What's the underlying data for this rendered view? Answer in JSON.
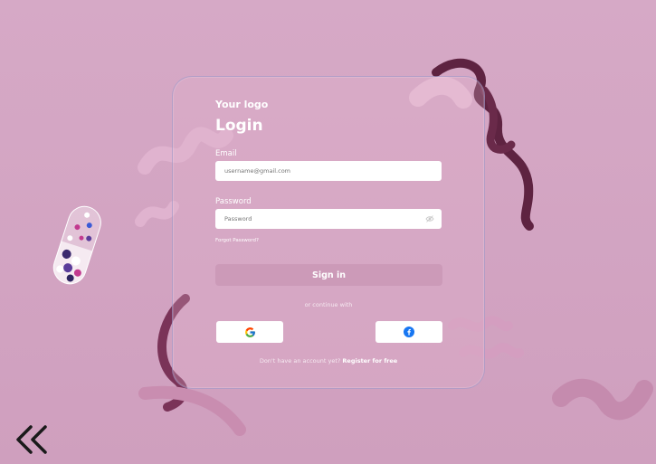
{
  "brand": {
    "logo_text": "Your logo"
  },
  "form": {
    "title": "Login",
    "email_label": "Email",
    "email_placeholder": "username@gmail.com",
    "password_label": "Password",
    "password_placeholder": "Password",
    "forgot_password": "Forgot Password?",
    "signin_label": "Sign in",
    "continue_text": "or continue with",
    "register_prompt": "Don't have an account yet?",
    "register_link": "Register for free"
  },
  "social": {
    "google_icon": "google-icon",
    "facebook_icon": "facebook-icon"
  },
  "nav": {
    "back_icon": "double-chevron-left-icon"
  },
  "colors": {
    "background": "#d3a6c3",
    "accent_dark": "#5a1f3a",
    "button": "#c896b4",
    "facebook": "#1877f2"
  }
}
